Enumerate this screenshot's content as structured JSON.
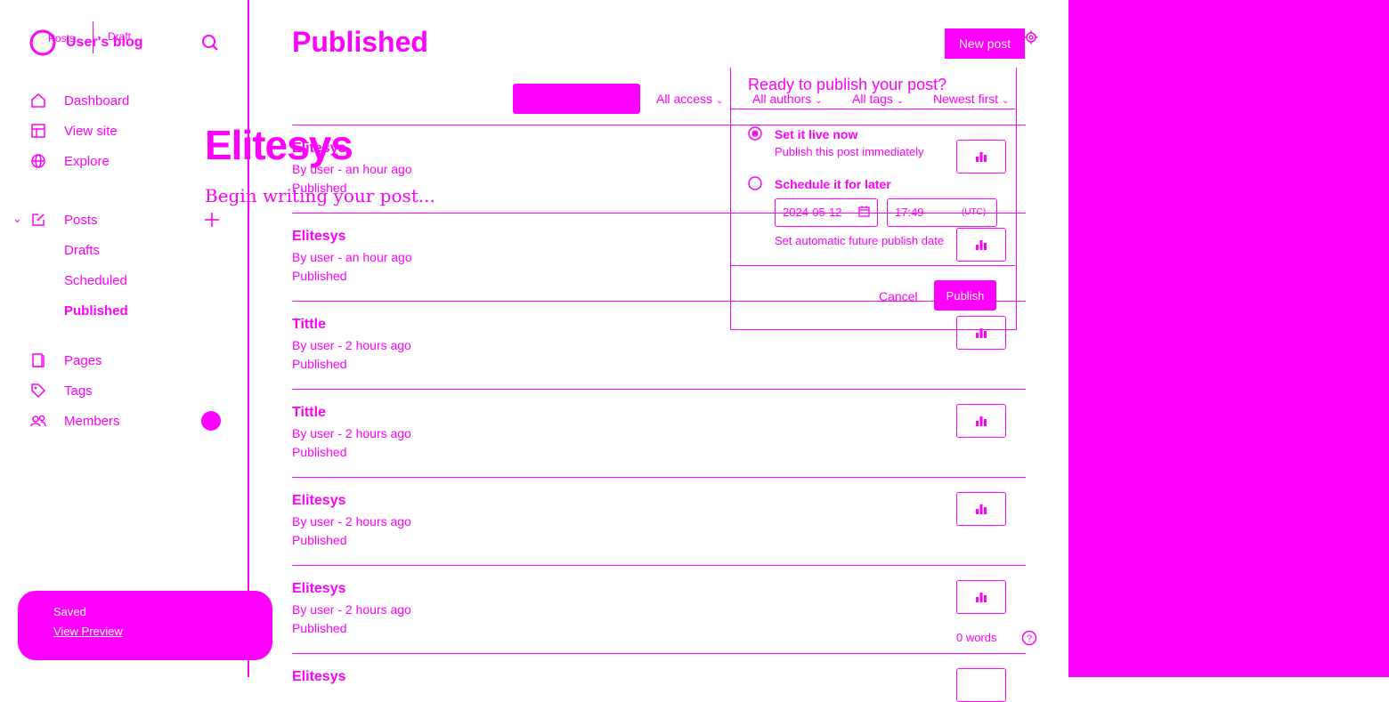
{
  "editor_header": {
    "crumb_posts": "Posts",
    "crumb_draft": "Draft"
  },
  "sidebar": {
    "blog_title": "User's blog",
    "nav": [
      {
        "label": "Dashboard",
        "icon": "home-icon"
      },
      {
        "label": "View site",
        "icon": "layout-icon"
      },
      {
        "label": "Explore",
        "icon": "globe-icon"
      }
    ],
    "posts": {
      "label": "Posts",
      "icon": "edit-icon",
      "sub": [
        "Drafts",
        "Scheduled",
        "Published"
      ],
      "active_sub": "Published"
    },
    "nav2": [
      {
        "label": "Pages",
        "icon": "page-icon"
      },
      {
        "label": "Tags",
        "icon": "tag-icon"
      },
      {
        "label": "Members",
        "icon": "members-icon"
      }
    ]
  },
  "main": {
    "title": "Published",
    "new_post_label": "New post",
    "filters": {
      "access": "All access",
      "authors": "All authors",
      "tags": "All tags",
      "sort": "Newest first"
    },
    "posts": [
      {
        "title": "Elitesys",
        "meta": "By user - an hour ago",
        "status": "Published"
      },
      {
        "title": "Elitesys",
        "meta": "By user - an hour ago",
        "status": "Published"
      },
      {
        "title": "Tittle",
        "meta": "By user - 2 hours ago",
        "status": "Published"
      },
      {
        "title": "Tittle",
        "meta": "By user - 2 hours ago",
        "status": "Published"
      },
      {
        "title": "Elitesys",
        "meta": "By user - 2 hours ago",
        "status": "Published"
      },
      {
        "title": "Elitesys",
        "meta": "By user - 2 hours ago",
        "status": "Published"
      },
      {
        "title": "Elitesys",
        "meta": "",
        "status": ""
      }
    ]
  },
  "editor": {
    "title": "Elitesys",
    "placeholder": "Begin writing your post...",
    "word_count": "0 words"
  },
  "publish_panel": {
    "heading": "Ready to publish your post?",
    "option_now": "Set it live now",
    "option_now_desc": "Publish this post immediately",
    "option_later": "Schedule it for later",
    "date": "2024-05-12",
    "time": "17:49",
    "tz": "(UTC)",
    "later_desc": "Set automatic future publish date",
    "cancel": "Cancel",
    "publish": "Publish"
  },
  "toast": {
    "status": "Saved",
    "link": "View Preview"
  },
  "colors": {
    "accent": "#ff00ff",
    "background": "#ffffff"
  }
}
